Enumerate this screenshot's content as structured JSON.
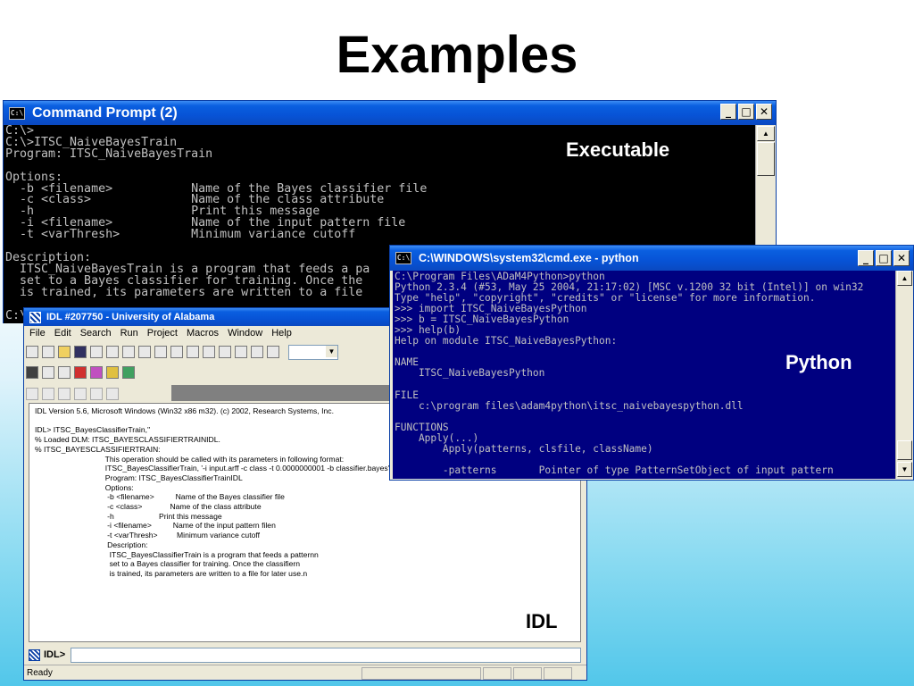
{
  "slide": {
    "title": "Examples"
  },
  "cmd1": {
    "title": "Command Prompt (2)",
    "icon_label": "C:\\",
    "label": "Executable",
    "lines": [
      "C:\\>",
      "C:\\>ITSC_NaiveBayesTrain",
      "Program: ITSC_NaiveBayesTrain",
      "",
      "Options:",
      "  -b <filename>           Name of the Bayes classifier file",
      "  -c <class>              Name of the class attribute",
      "  -h                      Print this message",
      "  -i <filename>           Name of the input pattern file",
      "  -t <varThresh>          Minimum variance cutoff",
      "",
      "Description:",
      "  ITSC_NaiveBayesTrain is a program that feeds a pa",
      "  set to a Bayes classifier for training. Once the",
      "  is trained, its parameters are written to a file",
      "",
      "C:\\"
    ]
  },
  "cmd2": {
    "title": "C:\\WINDOWS\\system32\\cmd.exe - python",
    "icon_label": "C:\\",
    "label": "Python",
    "lines": [
      "C:\\Program Files\\ADaM4Python>python",
      "Python 2.3.4 (#53, May 25 2004, 21:17:02) [MSC v.1200 32 bit (Intel)] on win32",
      "Type \"help\", \"copyright\", \"credits\" or \"license\" for more information.",
      ">>> import ITSC_NaiveBayesPython",
      ">>> b = ITSC_NaiveBayesPython",
      ">>> help(b)",
      "Help on module ITSC_NaiveBayesPython:",
      "",
      "NAME",
      "    ITSC_NaiveBayesPython",
      "",
      "FILE",
      "    c:\\program files\\adam4python\\itsc_naivebayespython.dll",
      "",
      "FUNCTIONS",
      "    Apply(...)",
      "        Apply(patterns, clsfile, className)",
      "",
      "        -patterns       Pointer of type PatternSetObject of input pattern"
    ]
  },
  "idl": {
    "title": "IDL #207750 - University of Alabama",
    "menu": [
      "File",
      "Edit",
      "Search",
      "Run",
      "Project",
      "Macros",
      "Window",
      "Help"
    ],
    "label": "IDL",
    "prompt": "IDL>",
    "status": "Ready",
    "log_lines": [
      "IDL Version 5.6, Microsoft Windows (Win32 x86 m32). (c) 2002, Research Systems, Inc.",
      "",
      "IDL> ITSC_BayesClassifierTrain,''",
      "% Loaded DLM: ITSC_BAYESCLASSIFIERTRAINIDL.",
      "% ITSC_BAYESCLASSIFIERTRAIN:",
      "                                 This operation should be called with its parameters in following format:",
      "                                 ITSC_BayesClassifierTrain, '-i input.arff -c class -t 0.0000000001 -b classifier.bayes'",
      "                                 Program: ITSC_BayesClassifierTrainIDL",
      "                                 Options:",
      "                                  -b <filename>          Name of the Bayes classifier file",
      "                                  -c <class>             Name of the class attribute",
      "                                  -h                     Print this message",
      "                                  -i <filename>          Name of the input pattern filen",
      "                                  -t <varThresh>         Minimum variance cutoff",
      "                                  Description:",
      "                                   ITSC_BayesClassifierTrain is a program that feeds a patternn",
      "                                   set to a Bayes classifier for training. Once the classifiern",
      "                                   is trained, its parameters are written to a file for later use.n"
    ]
  }
}
